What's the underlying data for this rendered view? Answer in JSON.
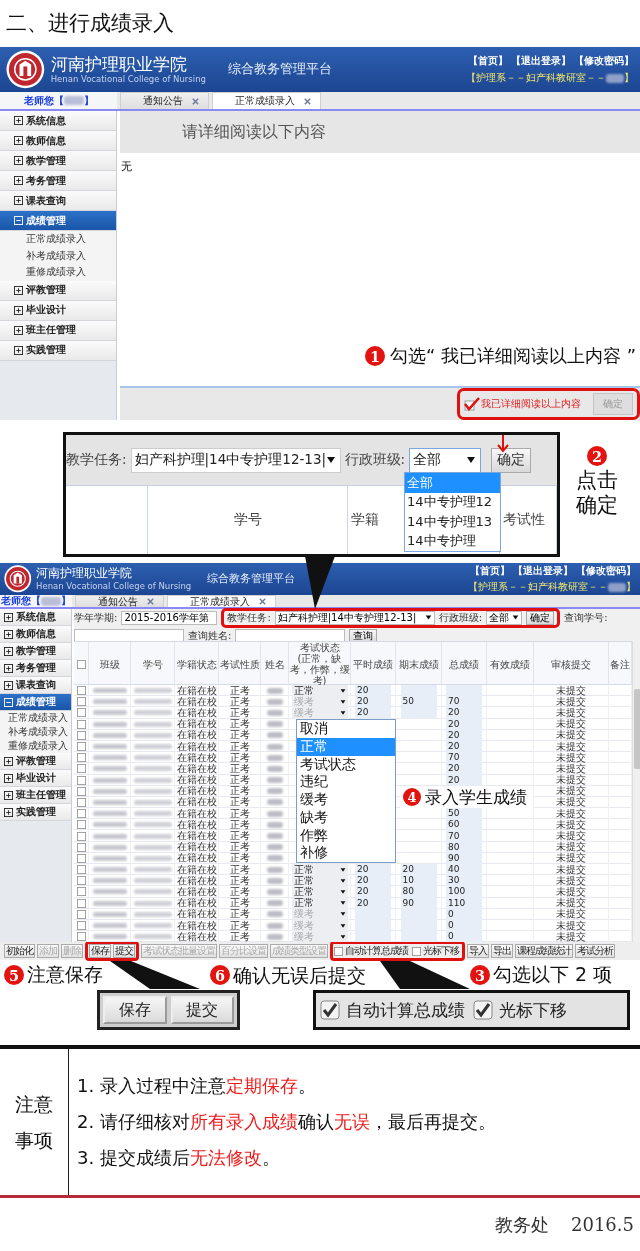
{
  "heading": "二、进行成绩录入",
  "screenshot_1": {
    "header": {
      "school_name": "河南护理职业学院",
      "school_name_en": "Henan Vocational College of Nursing",
      "platform": "综合教务管理平台",
      "links": [
        "【首页】",
        "【退出登录】",
        "【修改密码】"
      ],
      "department": "【护理系－－妇产科教研室－－",
      "department_end": "】"
    },
    "greeting": "老师您【",
    "greeting_end": "】",
    "tabs": [
      {
        "label": "通知公告",
        "selected": false
      },
      {
        "label": "正常成绩录入",
        "selected": true
      }
    ],
    "sidebar": [
      {
        "label": "系统信息",
        "expanded": false,
        "selected": false
      },
      {
        "label": "教师信息",
        "expanded": false,
        "selected": false
      },
      {
        "label": "教学管理",
        "expanded": false,
        "selected": false
      },
      {
        "label": "考务管理",
        "expanded": false,
        "selected": false
      },
      {
        "label": "课表查询",
        "expanded": false,
        "selected": false
      },
      {
        "label": "成绩管理",
        "expanded": true,
        "selected": true,
        "children": [
          {
            "label": "正常成绩录入"
          },
          {
            "label": "补考成绩录入"
          },
          {
            "label": "重修成绩录入"
          }
        ]
      },
      {
        "label": "评教管理",
        "expanded": false,
        "selected": false
      },
      {
        "label": "毕业设计",
        "expanded": false,
        "selected": false
      },
      {
        "label": "班主任管理",
        "expanded": false,
        "selected": false
      },
      {
        "label": "实践管理",
        "expanded": false,
        "selected": false
      }
    ],
    "notice": {
      "title": "请详细阅读以下内容",
      "body": "无"
    },
    "confirm_checkbox": {
      "label": "我已详细阅读以上内容",
      "checked": true
    },
    "confirm_button": {
      "label": "确定",
      "disabled": true
    },
    "callout": {
      "number": "1",
      "text": "勾选“ 我已详细阅读以上内容 ”"
    }
  },
  "zoom_filter": {
    "task_label": "教学任务:",
    "task_value": "妇产科护理|14中专护理12-13|",
    "class_label": "行政班级:",
    "class_value": "全部",
    "confirm": "确定",
    "class_options": [
      {
        "label": "全部",
        "selected": true
      },
      {
        "label": "14中专护理12",
        "selected": false
      },
      {
        "label": "14中专护理13",
        "selected": false
      },
      {
        "label": "14中专护理",
        "selected": false
      }
    ],
    "columns": [
      "学号",
      "学籍",
      "考试性"
    ],
    "callout": {
      "number": "2",
      "text": "点击确定"
    }
  },
  "screenshot_2": {
    "header": {
      "school_name": "河南护理职业学院",
      "school_name_en": "Henan Vocational College of Nursing",
      "platform": "综合教务管理平台",
      "links": [
        "【首页】",
        "【退出登录】",
        "【修改密码】"
      ],
      "department": "【护理系－－妇产科教研室－－",
      "department_end": "】"
    },
    "greeting": "老师您【",
    "greeting_end": "】",
    "tabs": [
      {
        "label": "通知公告",
        "selected": false
      },
      {
        "label": "正常成绩录入",
        "selected": true
      }
    ],
    "sidebar": [
      {
        "label": "系统信息",
        "expanded": false,
        "selected": false
      },
      {
        "label": "教师信息",
        "expanded": false,
        "selected": false
      },
      {
        "label": "教学管理",
        "expanded": false,
        "selected": false
      },
      {
        "label": "考务管理",
        "expanded": false,
        "selected": false
      },
      {
        "label": "课表查询",
        "expanded": false,
        "selected": false
      },
      {
        "label": "成绩管理",
        "expanded": true,
        "selected": true,
        "children": [
          {
            "label": "正常成绩录入"
          },
          {
            "label": "补考成绩录入"
          },
          {
            "label": "重修成绩录入"
          }
        ]
      },
      {
        "label": "评教管理",
        "expanded": false,
        "selected": false
      },
      {
        "label": "毕业设计",
        "expanded": false,
        "selected": false
      },
      {
        "label": "班主任管理",
        "expanded": false,
        "selected": false
      },
      {
        "label": "实践管理",
        "expanded": false,
        "selected": false
      }
    ],
    "filter": {
      "term_label": "学年学期:",
      "term_value": "2015-2016学年第",
      "task_label": "教学任务:",
      "task_value": "妇产科护理|14中专护理12-13|",
      "class_label": "行政班级:",
      "class_value": "全部",
      "confirm": "确定",
      "id_label": "查询学号:",
      "name_label": "查询姓名:",
      "search": "查询"
    },
    "all_checked": false,
    "columns": [
      {
        "label": "班级"
      },
      {
        "label": "学号"
      },
      {
        "label": "学籍状态"
      },
      {
        "label": "考试性质"
      },
      {
        "label": "姓名"
      },
      {
        "label": "考试状态",
        "note": "(正常，缺考，作弊，缓考)"
      },
      {
        "label": "平时成绩"
      },
      {
        "label": "期末成绩"
      },
      {
        "label": "总成绩"
      },
      {
        "label": "有效成绩"
      },
      {
        "label": "审核提交"
      },
      {
        "label": "备注"
      }
    ],
    "rows": [
      {
        "checked": false,
        "enrollment": "在籍在校",
        "exam_type": "正考",
        "status": "正常",
        "status_disabled": false,
        "usual": "20",
        "review": "未提交"
      },
      {
        "checked": false,
        "enrollment": "在籍在校",
        "exam_type": "正考",
        "status": "缓考",
        "status_disabled": true,
        "usual": "20",
        "final": "50",
        "total": "70",
        "review": "未提交"
      },
      {
        "checked": false,
        "enrollment": "在籍在校",
        "exam_type": "正考",
        "status": "缓考",
        "status_disabled": true,
        "usual": "20",
        "total": "20",
        "review": "未提交"
      },
      {
        "checked": false,
        "enrollment": "在籍在校",
        "exam_type": "正考",
        "total": "20",
        "review": "未提交"
      },
      {
        "checked": false,
        "enrollment": "在籍在校",
        "exam_type": "正考",
        "total": "20",
        "review": "未提交"
      },
      {
        "checked": false,
        "enrollment": "在籍在校",
        "exam_type": "正考",
        "total": "20",
        "review": "未提交"
      },
      {
        "checked": false,
        "enrollment": "在籍在校",
        "exam_type": "正考",
        "total": "70",
        "review": "未提交"
      },
      {
        "checked": false,
        "enrollment": "在籍在校",
        "exam_type": "正考",
        "total": "20",
        "review": "未提交"
      },
      {
        "checked": false,
        "enrollment": "在籍在校",
        "exam_type": "正考",
        "total": "20",
        "review": "未提交"
      },
      {
        "checked": false,
        "enrollment": "在籍在校",
        "exam_type": "正考",
        "review": "未提交"
      },
      {
        "checked": false,
        "enrollment": "在籍在校",
        "exam_type": "正考",
        "review": "未提交"
      },
      {
        "checked": false,
        "enrollment": "在籍在校",
        "exam_type": "正考",
        "total": "50",
        "review": "未提交"
      },
      {
        "checked": false,
        "enrollment": "在籍在校",
        "exam_type": "正考",
        "total": "60",
        "review": "未提交"
      },
      {
        "checked": false,
        "enrollment": "在籍在校",
        "exam_type": "正考",
        "total": "70",
        "review": "未提交"
      },
      {
        "checked": false,
        "enrollment": "在籍在校",
        "exam_type": "正考",
        "total": "80",
        "review": "未提交"
      },
      {
        "checked": false,
        "enrollment": "在籍在校",
        "exam_type": "正考",
        "total": "90",
        "review": "未提交"
      },
      {
        "checked": false,
        "enrollment": "在籍在校",
        "exam_type": "正考",
        "status": "正常",
        "status_disabled": false,
        "usual": "20",
        "final": "20",
        "total": "40",
        "review": "未提交"
      },
      {
        "checked": false,
        "enrollment": "在籍在校",
        "exam_type": "正考",
        "status": "正常",
        "status_disabled": false,
        "usual": "20",
        "final": "10",
        "total": "30",
        "review": "未提交"
      },
      {
        "checked": false,
        "enrollment": "在籍在校",
        "exam_type": "正考",
        "status": "正常",
        "status_disabled": false,
        "usual": "20",
        "final": "80",
        "total": "100",
        "review": "未提交"
      },
      {
        "checked": false,
        "enrollment": "在籍在校",
        "exam_type": "正考",
        "status": "正常",
        "status_disabled": false,
        "usual": "20",
        "final": "90",
        "total": "110",
        "review": "未提交"
      },
      {
        "checked": false,
        "enrollment": "在籍在校",
        "exam_type": "正考",
        "status": "缓考",
        "status_disabled": true,
        "total": "0",
        "review": "未提交"
      },
      {
        "checked": false,
        "enrollment": "在籍在校",
        "exam_type": "正考",
        "status": "缓考",
        "status_disabled": true,
        "total": "0",
        "review": "未提交"
      },
      {
        "checked": false,
        "enrollment": "在籍在校",
        "exam_type": "正考",
        "status": "缓考",
        "status_disabled": true,
        "total": "0",
        "review": "未提交"
      }
    ],
    "toolbar": [
      {
        "kind": "button",
        "label": "初始化",
        "disabled": false,
        "highlighted": false
      },
      {
        "kind": "button",
        "label": "添加",
        "disabled": true,
        "highlighted": false
      },
      {
        "kind": "button",
        "label": "删除",
        "disabled": true,
        "highlighted": false
      },
      {
        "kind": "button",
        "label": "保存",
        "disabled": false,
        "highlighted": true
      },
      {
        "kind": "button",
        "label": "提交",
        "disabled": false,
        "highlighted": true
      },
      {
        "kind": "button",
        "label": "考试状态批量设置",
        "disabled": true,
        "highlighted": false
      },
      {
        "kind": "button",
        "label": "百分比设置",
        "disabled": true,
        "highlighted": false
      },
      {
        "kind": "button",
        "label": "成绩类型设置",
        "disabled": true,
        "highlighted": false
      },
      {
        "kind": "checkbox",
        "label": "自动计算总成绩",
        "checked": false,
        "highlighted": true
      },
      {
        "kind": "checkbox",
        "label": "光标下移",
        "checked": false,
        "highlighted": true
      },
      {
        "kind": "button",
        "label": "导入",
        "disabled": false,
        "highlighted": false
      },
      {
        "kind": "button",
        "label": "导出",
        "disabled": false,
        "highlighted": false
      },
      {
        "kind": "button",
        "label": "课程成绩统计",
        "disabled": false,
        "highlighted": false
      },
      {
        "kind": "button",
        "label": "考试分析",
        "disabled": false,
        "highlighted": false
      }
    ],
    "status_menu": [
      {
        "label": "取消",
        "selected": false
      },
      {
        "label": "正常",
        "selected": true
      },
      {
        "label": "考试状态",
        "selected": false
      },
      {
        "label": "违纪",
        "selected": false
      },
      {
        "label": "缓考",
        "selected": false
      },
      {
        "label": "缺考",
        "selected": false
      },
      {
        "label": "作弊",
        "selected": false
      },
      {
        "label": "补修",
        "selected": false
      }
    ],
    "callout": {
      "number": "4",
      "text": "录入学生成绩"
    }
  },
  "steps": [
    {
      "number": "5",
      "text": "注意保存"
    },
    {
      "number": "6",
      "text": "确认无误后提交"
    },
    {
      "number": "3",
      "text": "勾选以下 2 项"
    }
  ],
  "zoom_buttons": [
    "保存",
    "提交"
  ],
  "zoom_checkboxes": [
    {
      "label": "自动计算总成绩",
      "checked": true
    },
    {
      "label": "光标下移",
      "checked": true
    }
  ],
  "notes": {
    "title": "注意事项",
    "items": [
      "1. 录入过程中注意**定期保存**。",
      "2. 请仔细核对**所有录入成绩**确认**无误**，最后再提交。",
      "3. 提交成绩后**无法修改**。"
    ]
  },
  "footer": {
    "office": "教务处",
    "date": "2016.5"
  }
}
